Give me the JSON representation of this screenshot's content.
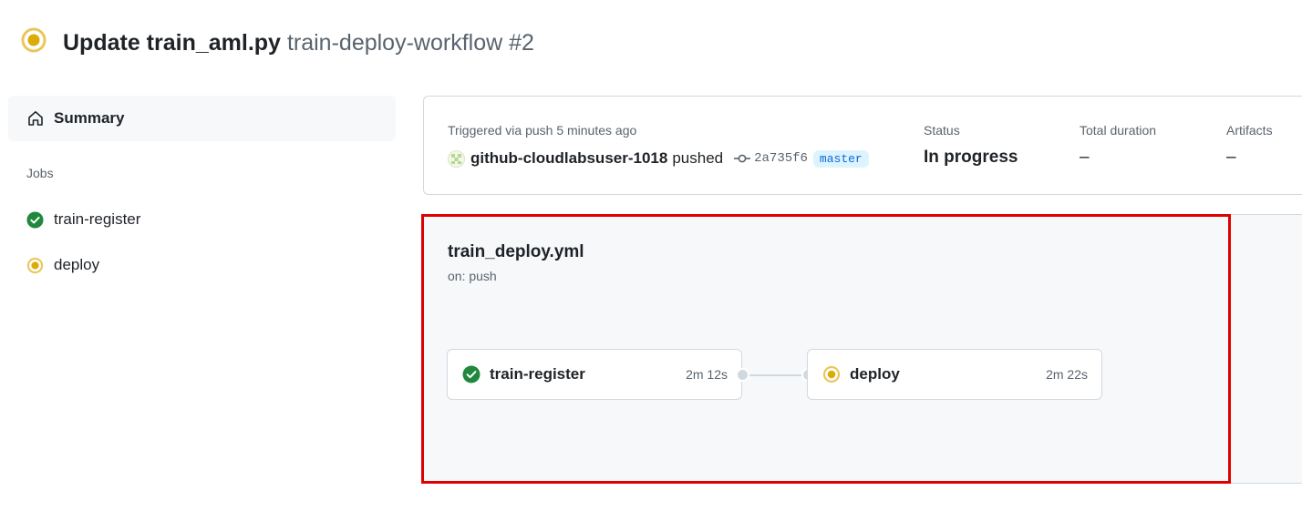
{
  "header": {
    "title": "Update train_aml.py",
    "subtitle": "train-deploy-workflow #2",
    "status_icon": "in-progress-icon"
  },
  "sidebar": {
    "summary_label": "Summary",
    "summary_icon": "home-icon",
    "jobs_heading": "Jobs",
    "jobs": [
      {
        "label": "train-register",
        "status": "success",
        "icon": "check-circle-icon"
      },
      {
        "label": "deploy",
        "status": "in_progress",
        "icon": "in-progress-icon"
      }
    ]
  },
  "summary": {
    "triggered_label": "Triggered via push 5 minutes ago",
    "actor": "github-cloudlabsuser-1018",
    "action": "pushed",
    "commit_sha": "2a735f6",
    "branch": "master",
    "status_label": "Status",
    "status_value": "In progress",
    "duration_label": "Total duration",
    "duration_value": "–",
    "artifacts_label": "Artifacts",
    "artifacts_value": "–"
  },
  "workflow": {
    "file_name": "train_deploy.yml",
    "trigger": "on: push",
    "jobs": [
      {
        "name": "train-register",
        "duration": "2m 12s",
        "status": "success"
      },
      {
        "name": "deploy",
        "duration": "2m 22s",
        "status": "in_progress"
      }
    ]
  },
  "colors": {
    "success": "#1a7f37",
    "in_progress": "#dbab0a",
    "highlight": "#e00000",
    "link": "#0969da"
  }
}
